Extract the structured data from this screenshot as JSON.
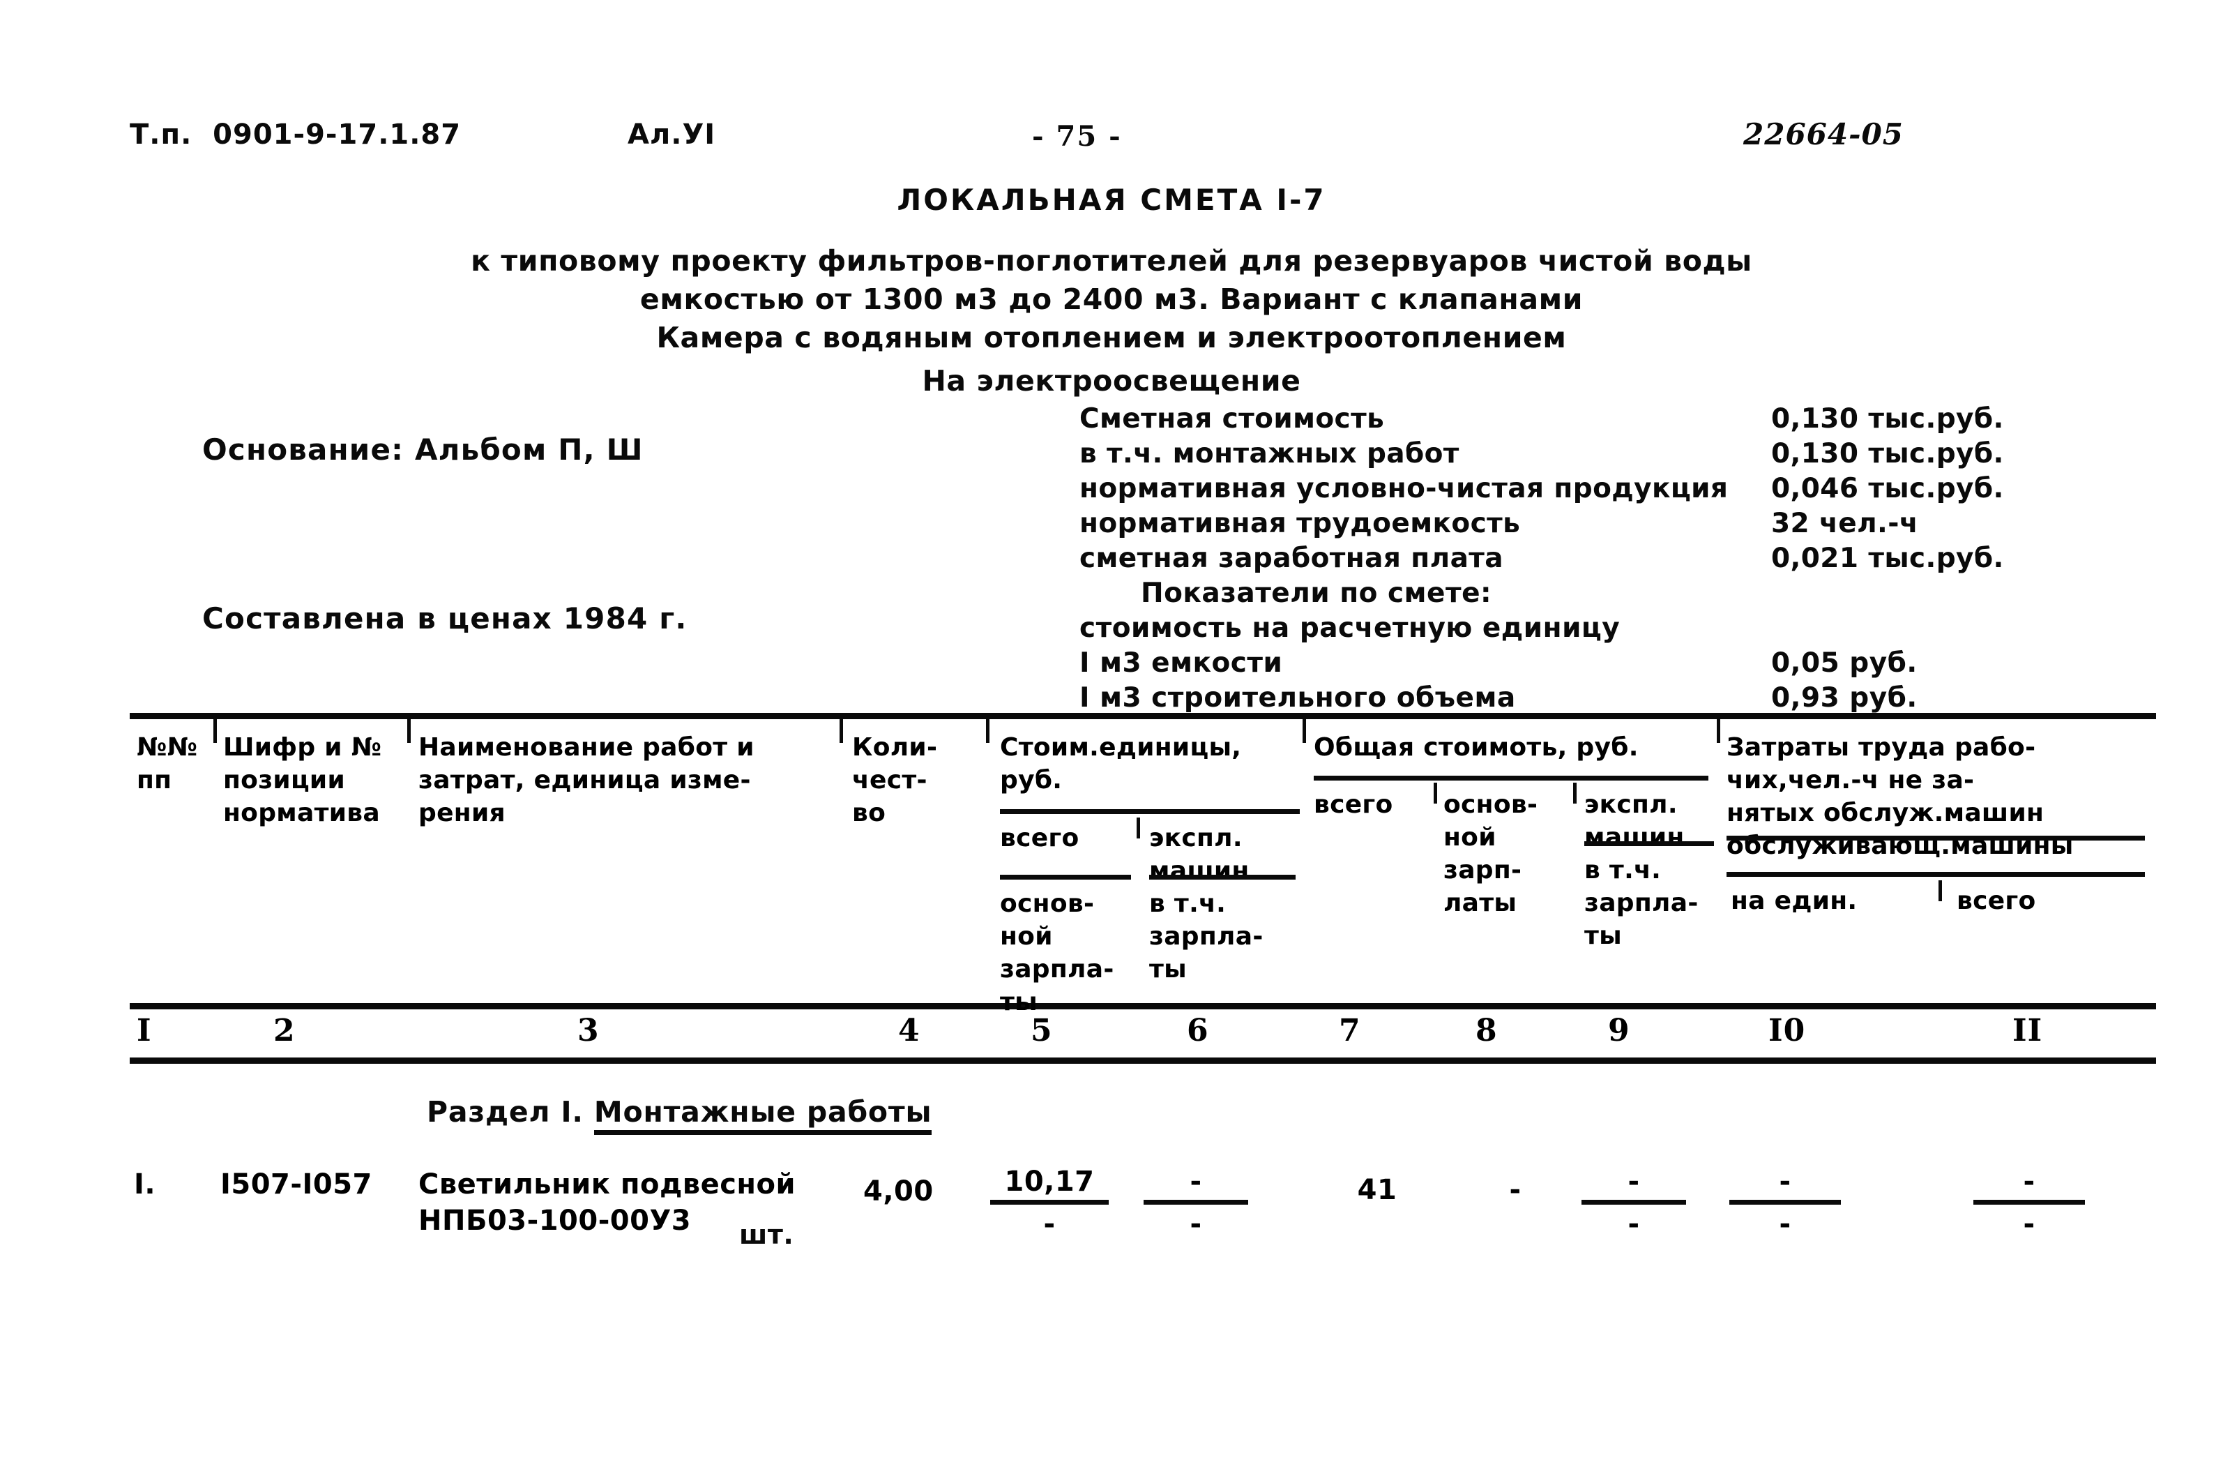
{
  "header": {
    "doc_code": "Т.п.  0901-9-17.1.87",
    "album_code": "Ал.УI",
    "page_number": "- 75 -",
    "archive_code": "22664-05"
  },
  "titles": {
    "estimate_title": "ЛОКАЛЬНАЯ СМЕТА I-7",
    "subtitle_1": "к типовому проекту фильтров-поглотителей для резервуаров чистой воды",
    "subtitle_2": "емкостью от 1300 м3 до 2400 м3. Вариант с клапанами",
    "subtitle_3": "Камера с водяным отоплением и электроотоплением",
    "subtitle_4": "На электроосвещение"
  },
  "info": {
    "basis": "Основание: Альбом П, Ш",
    "prices": "Составлена в ценах 1984 г."
  },
  "summary": {
    "rows": [
      {
        "label": "Сметная стоимость",
        "value": "0,130 тыс.руб."
      },
      {
        "label": "в т.ч. монтажных работ",
        "value": "0,130 тыс.руб."
      },
      {
        "label": "нормативная условно-чистая продукция",
        "value": "0,046 тыс.руб."
      },
      {
        "label": "нормативная трудоемкость",
        "value": "32 чел.-ч"
      },
      {
        "label": "сметная заработная плата",
        "value": "0,021 тыс.руб."
      }
    ],
    "indicators_heading": "Показатели по смете:",
    "indicators_subheading": "стоимость на расчетную единицу",
    "indicators": [
      {
        "label": "I м3 емкости",
        "value": "0,05 руб."
      },
      {
        "label": "I м3 строительного объема",
        "value": "0,93 руб."
      }
    ]
  },
  "table": {
    "headers": {
      "col1": "№№\nпп",
      "col2": "Шифр и №\nпозиции\nнорматива",
      "col3": "Наименование работ и\nзатрат, единица изме-\nрения",
      "col4": "Коли-\nчест-\nво",
      "col56_title": "Стоим.единицы,\nруб.",
      "col5a": "всего",
      "col6a": "экспл.\nмашин",
      "col5b": "основ-\nной\nзарпла-\nты",
      "col6b": "в т.ч.\nзарпла-\nты",
      "col789_title": "Общая стоимоть, руб.",
      "col7": "всего",
      "col8": "основ-\nной\nзарп-\nлаты",
      "col9a": "экспл.\nмашин",
      "col9b": "в т.ч.\nзарпла-\nты",
      "col1011_title": "Затраты труда рабо-\nчих,чел.-ч не за-\nнятых обслуж.машин\nобслуживающ.машины",
      "col10": "на един.",
      "col11": "всего"
    },
    "column_numbers": [
      "I",
      "2",
      "3",
      "4",
      "5",
      "6",
      "7",
      "8",
      "9",
      "I0",
      "II"
    ],
    "section_heading": {
      "prefix": "Раздел I. ",
      "name": "Монтажные работы"
    },
    "rows": [
      {
        "num": "I.",
        "code": "I507-I057",
        "name": "Светильник подвесной\nНПБ03-100-00У3",
        "unit": "шт.",
        "qty": "4,00",
        "unit_cost_total": "10,17",
        "unit_cost_base_wage": "-",
        "unit_cost_machines": "-",
        "unit_cost_machines_wage": "-",
        "total_cost_all": "41",
        "total_cost_base_wage": "-",
        "total_cost_machines": "-",
        "total_cost_machines_wage": "-",
        "labor_per_unit_top": "-",
        "labor_per_unit_bottom": "-",
        "labor_total_top": "-",
        "labor_total_bottom": "-"
      }
    ]
  }
}
